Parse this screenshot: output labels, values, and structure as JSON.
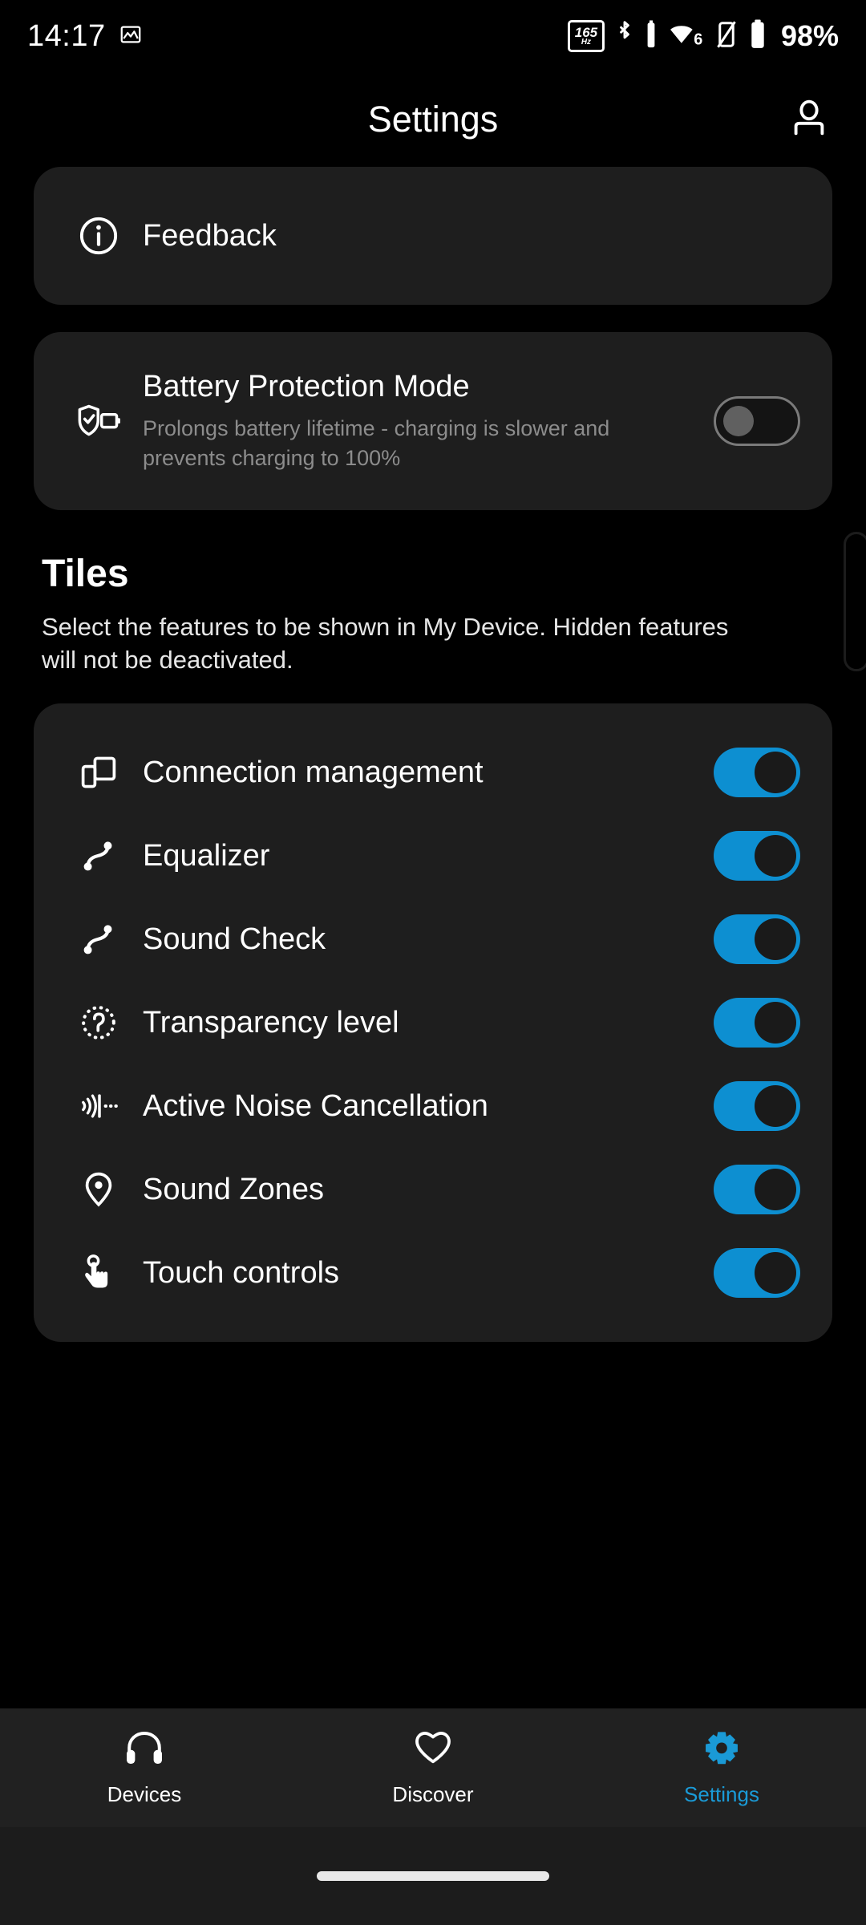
{
  "status_bar": {
    "time": "14:17",
    "screenshot_icon": "image-icon",
    "refresh_rate_value": "165",
    "refresh_rate_unit": "Hz",
    "bluetooth_icon": "bluetooth-icon",
    "bluetooth_battery_icon": "bluetooth-battery-icon",
    "wifi_icon": "wifi-icon",
    "wifi_generation": "6",
    "vibrate_icon": "vibrate-mode-icon",
    "battery_icon": "battery-icon",
    "battery_percent": "98%"
  },
  "header": {
    "title": "Settings",
    "account_icon": "account-icon"
  },
  "feedback": {
    "label": "Feedback",
    "icon": "info-circle-icon"
  },
  "battery_protection": {
    "title": "Battery Protection Mode",
    "description": "Prolongs battery lifetime - charging is slower and prevents charging to 100%",
    "icon": "shield-battery-icon",
    "toggle_state": "off"
  },
  "tiles": {
    "title": "Tiles",
    "subtitle": "Select the features to be shown in My Device. Hidden features will not be deactivated.",
    "items": [
      {
        "label": "Connection management",
        "icon": "devices-icon",
        "toggle_state": "on"
      },
      {
        "label": "Equalizer",
        "icon": "equalizer-curve-icon",
        "toggle_state": "on"
      },
      {
        "label": "Sound Check",
        "icon": "equalizer-curve-icon",
        "toggle_state": "on"
      },
      {
        "label": "Transparency level",
        "icon": "transparency-ear-icon",
        "toggle_state": "on"
      },
      {
        "label": "Active Noise Cancellation",
        "icon": "noise-cancellation-icon",
        "toggle_state": "on"
      },
      {
        "label": "Sound Zones",
        "icon": "location-pin-icon",
        "toggle_state": "on"
      },
      {
        "label": "Touch controls",
        "icon": "touch-hand-icon",
        "toggle_state": "on"
      }
    ]
  },
  "bottom_nav": {
    "items": [
      {
        "label": "Devices",
        "icon": "headphones-icon",
        "active": false
      },
      {
        "label": "Discover",
        "icon": "heart-icon",
        "active": false
      },
      {
        "label": "Settings",
        "icon": "gear-icon",
        "active": true
      }
    ]
  },
  "colors": {
    "accent": "#0d8fd1",
    "nav_active": "#1a9ad6",
    "card_bg": "#1e1e1e",
    "page_bg": "#000000"
  }
}
